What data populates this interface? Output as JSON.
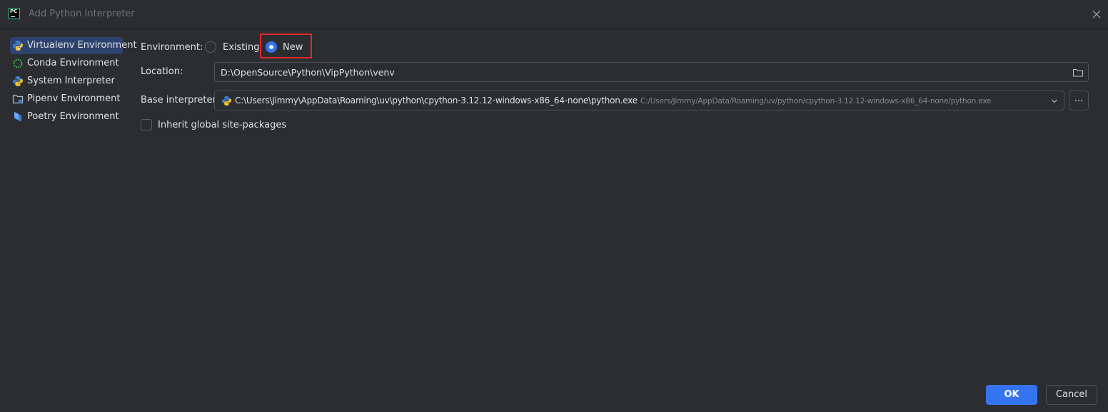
{
  "window": {
    "title": "Add Python Interpreter",
    "app_logo_text": "PC"
  },
  "sidebar": {
    "items": [
      {
        "label": "Virtualenv Environment",
        "icon": "virtualenv-icon",
        "selected": true
      },
      {
        "label": "Conda Environment",
        "icon": "conda-icon",
        "selected": false
      },
      {
        "label": "System Interpreter",
        "icon": "python-icon",
        "selected": false
      },
      {
        "label": "Pipenv Environment",
        "icon": "pipenv-icon",
        "selected": false
      },
      {
        "label": "Poetry Environment",
        "icon": "poetry-icon",
        "selected": false
      }
    ]
  },
  "form": {
    "environment_label": "Environment:",
    "radio_existing": "Existing",
    "radio_new": "New",
    "selected_environment": "New",
    "location_label": "Location:",
    "location_value": "D:\\OpenSource\\Python\\VipPython\\venv",
    "base_interpreter_label": "Base interpreter:",
    "base_interpreter_value": "C:\\Users\\Jimmy\\AppData\\Roaming\\uv\\python\\cpython-3.12.12-windows-x86_64-none\\python.exe",
    "base_interpreter_hint": "C:/Users/Jimmy/AppData/Roaming/uv/python/cpython-3.12.12-windows-x86_64-none/python.exe",
    "browse_label": "...",
    "inherit_label": "Inherit global site-packages",
    "inherit_checked": false
  },
  "buttons": {
    "ok": "OK",
    "cancel": "Cancel"
  },
  "colors": {
    "accent": "#3574f0",
    "background": "#2b2d30",
    "selection": "#2e436e",
    "highlight": "#e0272e"
  }
}
